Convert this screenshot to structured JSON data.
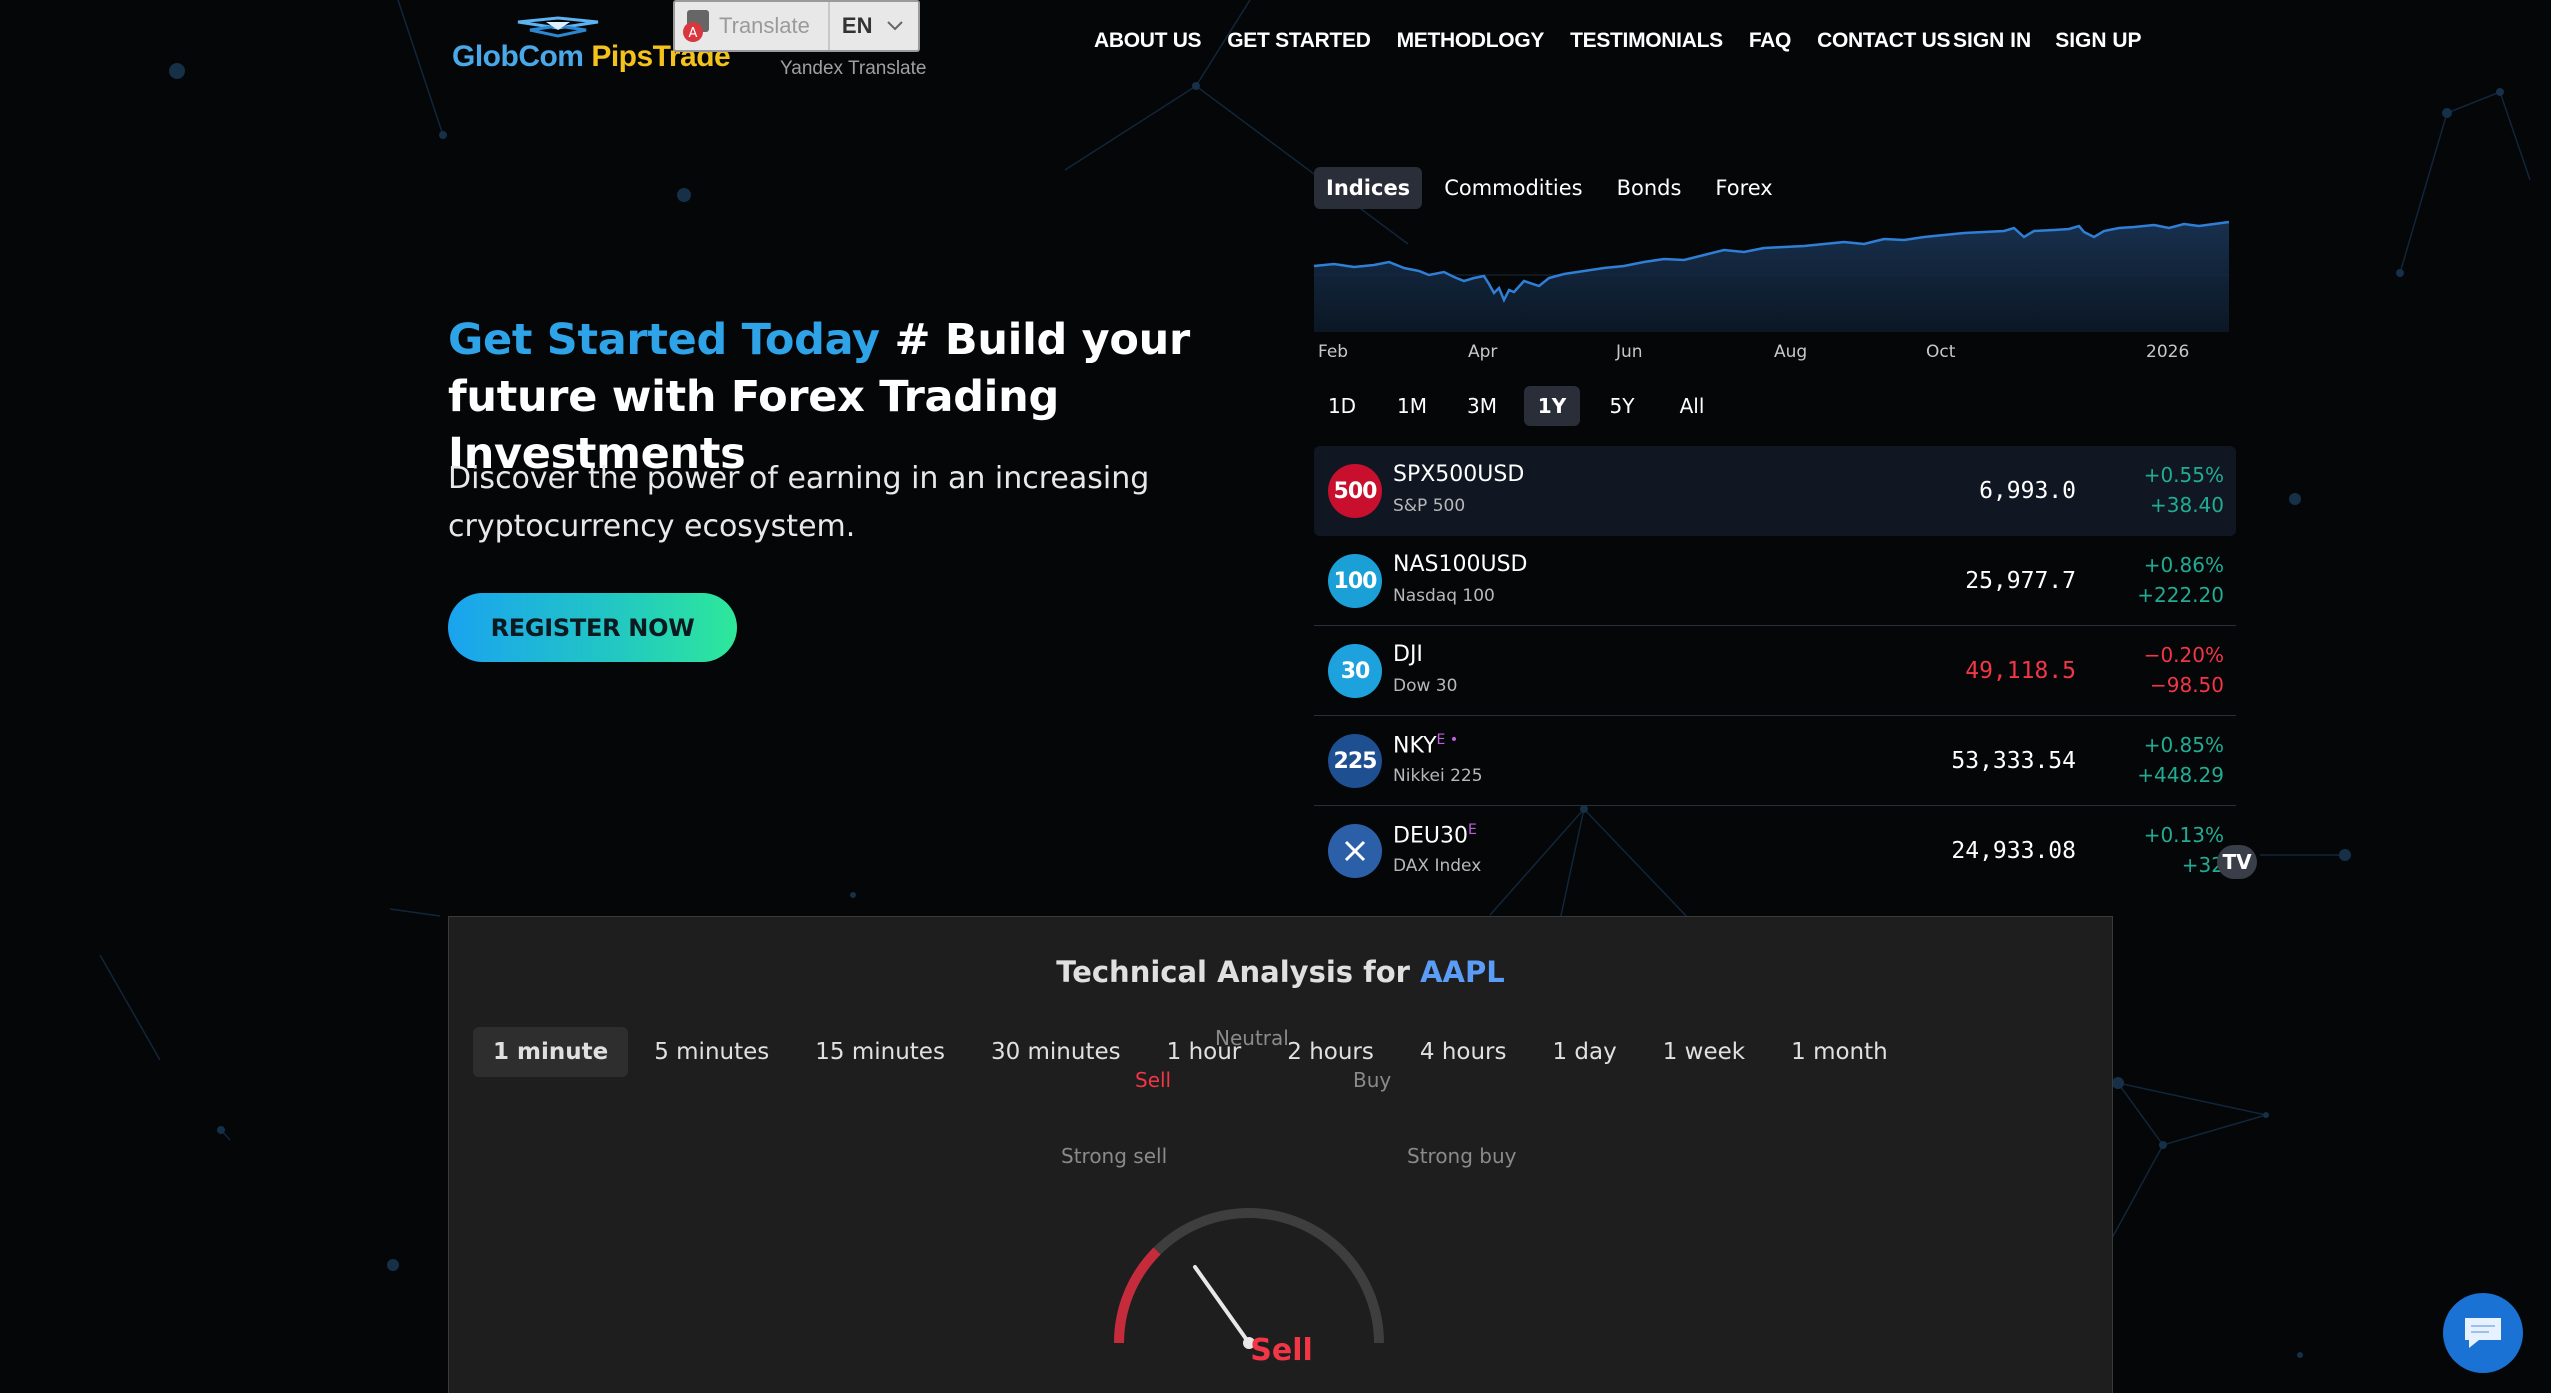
{
  "header": {
    "logo": {
      "part1": "GlobCom ",
      "part2": "PipsTrade"
    },
    "translate": {
      "label": "Translate",
      "language": "EN",
      "provider": "Yandex Translate"
    },
    "nav": [
      "ABOUT US",
      "GET STARTED",
      "METHODLOGY",
      "TESTIMONIALS",
      "FAQ",
      "CONTACT US"
    ],
    "auth": {
      "signin": "SIGN IN",
      "signup": "SIGN UP"
    }
  },
  "hero": {
    "title_accent": "Get Started Today",
    "title_rest": " # Build your future with Forex Trading Investments",
    "subtitle": "Discover the power of earning in an increasing cryptocurrency ecosystem.",
    "cta": "REGISTER NOW"
  },
  "market": {
    "tabs": [
      "Indices",
      "Commodities",
      "Bonds",
      "Forex"
    ],
    "active_tab": 0,
    "axis_labels": [
      "Feb",
      "Apr",
      "Jun",
      "Aug",
      "Oct",
      "2026"
    ],
    "ranges": [
      "1D",
      "1M",
      "3M",
      "1Y",
      "5Y",
      "All"
    ],
    "active_range": 3,
    "symbols": [
      {
        "badge": "500",
        "badge_color": "#c8102e",
        "name": "SPX500USD",
        "desc": "S&P 500",
        "price": "6,993.0",
        "chg_pct": "+0.55%",
        "chg": "+38.40",
        "dir": "up",
        "price_dir": "flat",
        "sup": ""
      },
      {
        "badge": "100",
        "badge_color": "#1a9fd6",
        "name": "NAS100USD",
        "desc": "Nasdaq 100",
        "price": "25,977.7",
        "chg_pct": "+0.86%",
        "chg": "+222.20",
        "dir": "up",
        "price_dir": "flat",
        "sup": ""
      },
      {
        "badge": "30",
        "badge_color": "#1ea2dd",
        "name": "DJI",
        "desc": "Dow 30",
        "price": "49,118.5",
        "chg_pct": "−0.20%",
        "chg": "−98.50",
        "dir": "down",
        "price_dir": "down",
        "sup": ""
      },
      {
        "badge": "225",
        "badge_color": "#1d4f91",
        "name": "NKY",
        "desc": "Nikkei 225",
        "price": "53,333.54",
        "chg_pct": "+0.85%",
        "chg": "+448.29",
        "dir": "up",
        "price_dir": "flat",
        "sup": "E •"
      },
      {
        "badge": "",
        "badge_color": "#2b5fa8",
        "name": "DEU30",
        "desc": "DAX Index",
        "price": "24,933.08",
        "chg_pct": "+0.13%",
        "chg": "+32",
        "dir": "up",
        "price_dir": "flat",
        "sup": "E"
      }
    ],
    "tv_logo": "TV"
  },
  "analysis": {
    "title_prefix": "Technical Analysis for ",
    "symbol": "AAPL",
    "intervals": [
      "1 minute",
      "5 minutes",
      "15 minutes",
      "30 minutes",
      "1 hour",
      "2 hours",
      "4 hours",
      "1 day",
      "1 week",
      "1 month"
    ],
    "active_interval": 0,
    "gauge_labels": {
      "strong_sell": "Strong sell",
      "sell": "Sell",
      "neutral": "Neutral",
      "buy": "Buy",
      "strong_buy": "Strong buy"
    },
    "result": "Sell"
  },
  "colors": {
    "accent": "#2fa3e8",
    "up": "#22ab94",
    "down": "#f23645",
    "chart_line": "#2f7fd6"
  }
}
